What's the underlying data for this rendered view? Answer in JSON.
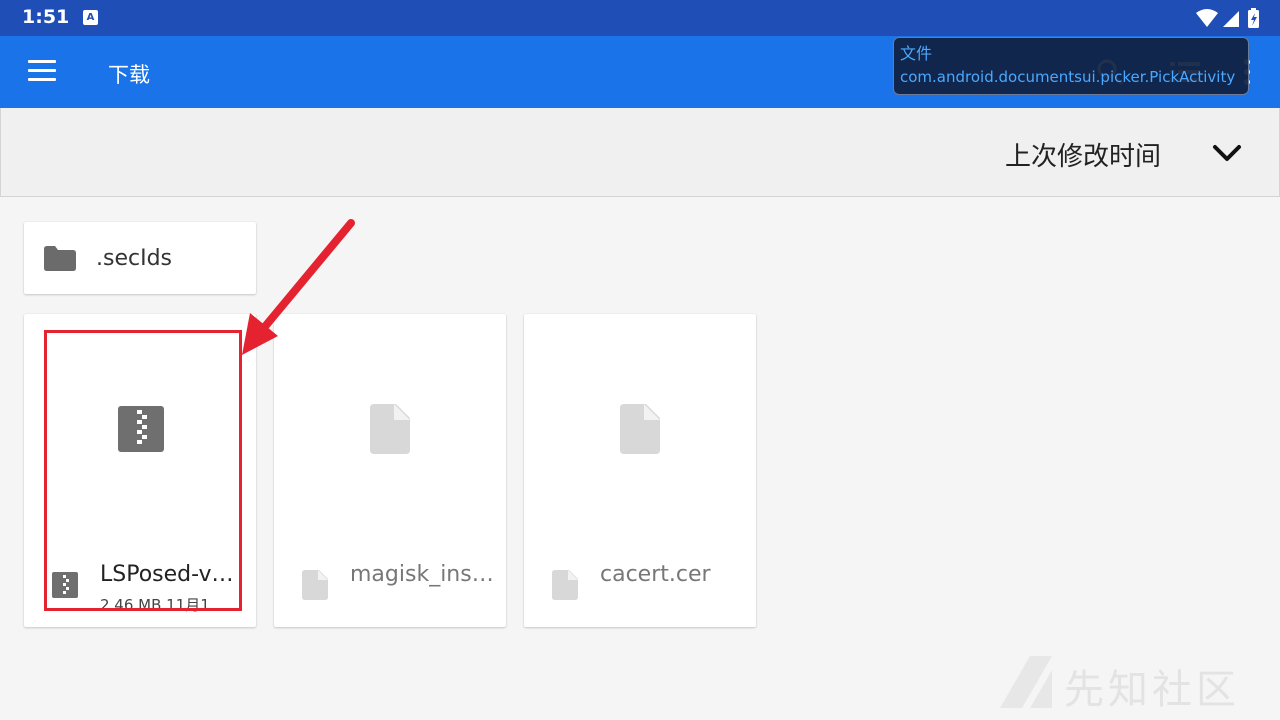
{
  "status_bar": {
    "time": "1:51",
    "notification_icon_letter": "A",
    "icons": [
      "wifi-icon",
      "cell-signal-icon",
      "battery-icon"
    ]
  },
  "app_bar": {
    "title": "下载",
    "icons": [
      "menu-icon",
      "search-icon",
      "list-view-icon",
      "overflow-menu-icon"
    ]
  },
  "overlay": {
    "line1": "文件",
    "line2": "com.android.documentsui.picker.PickActivity"
  },
  "sort": {
    "label": "上次修改时间"
  },
  "folders": [
    {
      "name": ".secIds",
      "icon": "folder-icon"
    }
  ],
  "files": [
    {
      "name": "LSPosed-v…",
      "meta": "2.46 MB 11月1",
      "icon": "archive-icon",
      "enabled": true
    },
    {
      "name": "magisk_ins…",
      "icon": "document-icon",
      "enabled": false
    },
    {
      "name": "cacert.cer",
      "icon": "document-icon",
      "enabled": false
    }
  ],
  "watermark": {
    "text": "先知社区"
  },
  "colors": {
    "status_bar": "#1f4fb6",
    "app_bar": "#1a73e8",
    "background": "#f5f5f5",
    "annotation_red": "#e52330",
    "overlay_text": "#4aa8ff"
  }
}
